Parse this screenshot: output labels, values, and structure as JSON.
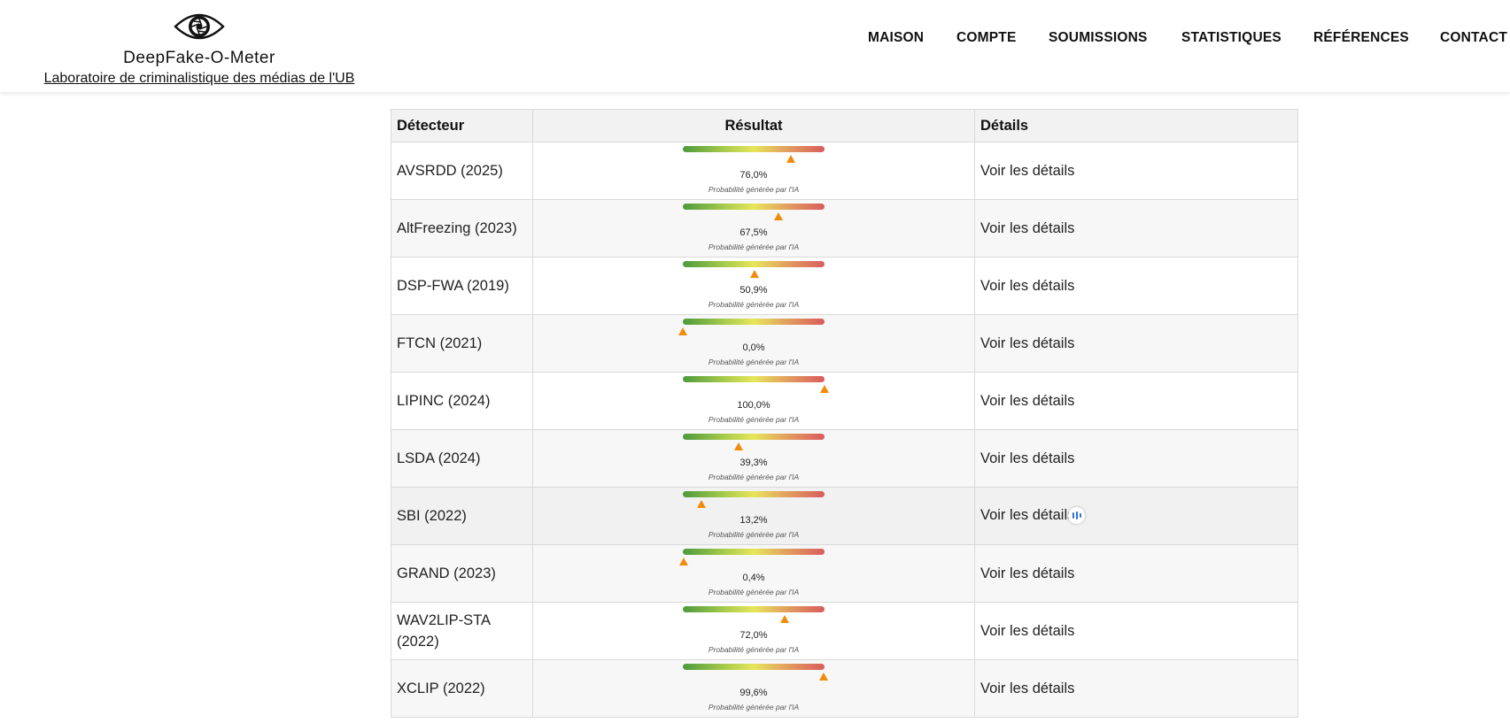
{
  "brand": {
    "name": "DeepFake-O-Meter",
    "subtitle": "Laboratoire de criminalistique des médias de l'UB",
    "logo_icon": "eye-camera-logo"
  },
  "nav": {
    "items": [
      "MAISON",
      "COMPTE",
      "SOUMISSIONS",
      "STATISTIQUES",
      "RÉFÉRENCES",
      "CONTACT"
    ]
  },
  "table": {
    "headers": {
      "detector": "Détecteur",
      "result": "Résultat",
      "details": "Détails"
    },
    "caption": "Probabilité générée par l'IA",
    "details_link": "Voir les détails",
    "gauge_colors": [
      "#4c9a3c",
      "#e6e65a",
      "#d95c5c"
    ],
    "marker_color": "#f08c0a",
    "rows": [
      {
        "detector": "AVSRDD (2025)",
        "probability_label": "76,0%",
        "probability": 76.0
      },
      {
        "detector": "AltFreezing (2023)",
        "probability_label": "67,5%",
        "probability": 67.5
      },
      {
        "detector": "DSP-FWA (2019)",
        "probability_label": "50,9%",
        "probability": 50.9
      },
      {
        "detector": "FTCN (2021)",
        "probability_label": "0,0%",
        "probability": 0.0
      },
      {
        "detector": "LIPINC (2024)",
        "probability_label": "100,0%",
        "probability": 100.0
      },
      {
        "detector": "LSDA (2024)",
        "probability_label": "39,3%",
        "probability": 39.3
      },
      {
        "detector": "SBI (2022)",
        "probability_label": "13,2%",
        "probability": 13.2
      },
      {
        "detector": "GRAND (2023)",
        "probability_label": "0,4%",
        "probability": 0.4
      },
      {
        "detector": "WAV2LIP-STA (2022)",
        "probability_label": "72,0%",
        "probability": 72.0
      },
      {
        "detector": "XCLIP (2022)",
        "probability_label": "99,6%",
        "probability": 99.6
      }
    ]
  }
}
